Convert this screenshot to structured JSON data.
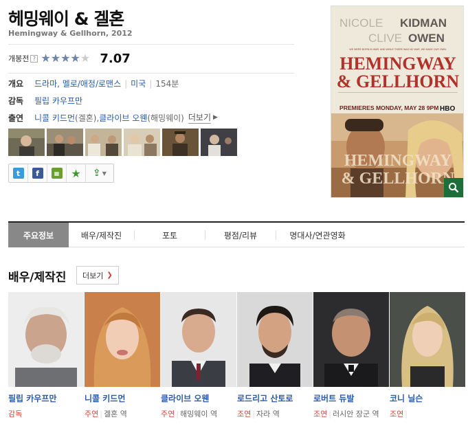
{
  "movie": {
    "title": "헤밍웨이 & 겔혼",
    "subtitle": "Hemingway & Gellhorn, 2012",
    "rating_label": "개봉전",
    "rating_help": "?",
    "rating_score": "7.07",
    "rating_fraction": 0.707
  },
  "info": {
    "overview_label": "개요",
    "genre": "드라마, 멜로/애정/로맨스",
    "country": "미국",
    "runtime": "154분",
    "director_label": "감독",
    "director": "필립 카우프만",
    "cast_label": "출연",
    "cast1_name": "니콜 키드먼",
    "cast1_role": "(겔혼), ",
    "cast2_name": "클라이브 오웬",
    "cast2_role": "(해밍웨이)",
    "more": "더보기"
  },
  "share_icons": [
    "twitter-icon",
    "facebook-icon",
    "me2day-icon",
    "bookmark-star-icon",
    "share-icon"
  ],
  "poster": {
    "actor1_a": "NICOLE",
    "actor1_b": "KIDMAN",
    "actor2_a": "CLIVE",
    "actor2_b": "OWEN",
    "tagline": "WE WERE BORN IN WAR. AND WHILE THERE WAS NO WAR, WE MADE OUR OWN.",
    "title_line1": "HEMINGWAY",
    "title_line2": "& GELLHORN",
    "premiere": "PREMIERES MONDAY, MAY 28 9PM",
    "network": "HBO"
  },
  "tabs": [
    "주요정보",
    "배우/제작진",
    "포토",
    "평점/리뷰",
    "명대사/연관영화"
  ],
  "section": {
    "title": "배우/제작진",
    "more": "더보기"
  },
  "cast_list": [
    {
      "name": "필립 카우프만",
      "role": "감독",
      "character": ""
    },
    {
      "name": "니콜 키드먼",
      "role": "주연",
      "character": "겔혼 역"
    },
    {
      "name": "클라이브 오웬",
      "role": "주연",
      "character": "해밍웨이 역"
    },
    {
      "name": "로드리고 산토로",
      "role": "조연",
      "character": "자라 역"
    },
    {
      "name": "로버트 듀발",
      "role": "조연",
      "character": "러시안 장군 역"
    },
    {
      "name": "코니 닐슨",
      "role": "조연",
      "character": ""
    }
  ],
  "colors": {
    "link": "#2b5ba8",
    "role": "#d8473d",
    "star": "#6f86a6",
    "tab_active": "#888888",
    "poster_red": "#b0322a"
  }
}
